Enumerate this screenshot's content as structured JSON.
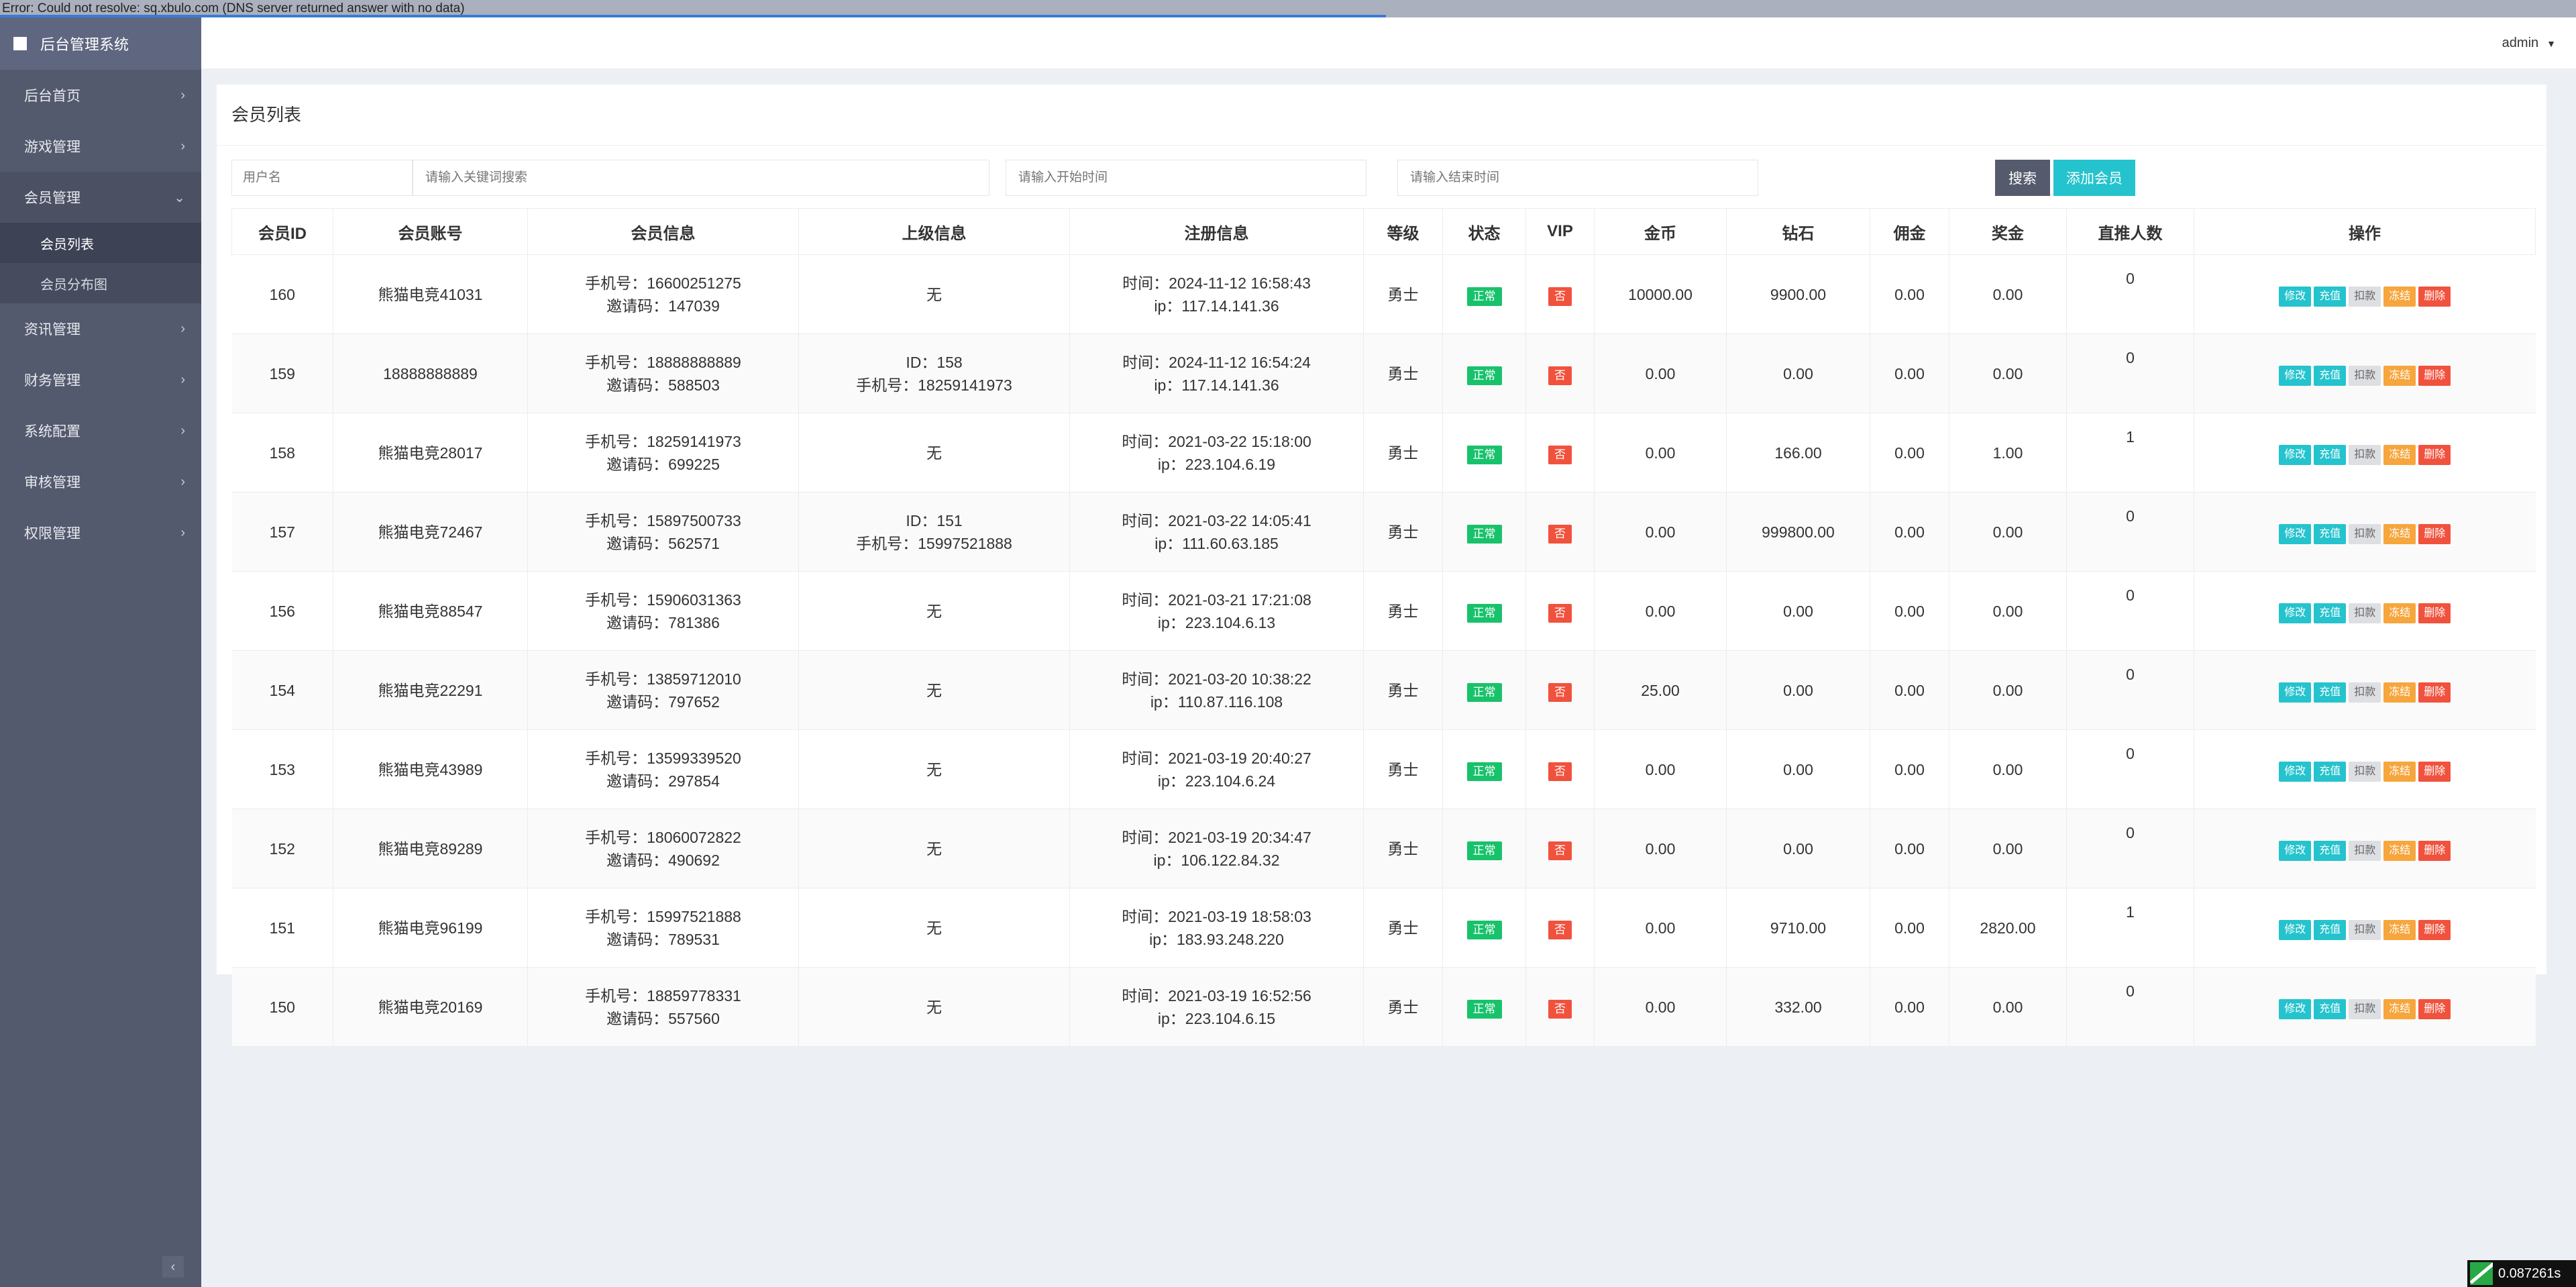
{
  "error_bar": {
    "text": "Error: Could not resolve: sq.xbulo.com (DNS server returned answer with no data)"
  },
  "sidebar": {
    "brand": "后台管理系统",
    "items": [
      {
        "label": "后台首页"
      },
      {
        "label": "游戏管理"
      },
      {
        "label": "会员管理",
        "open": true,
        "children": [
          {
            "label": "会员列表",
            "active": true
          },
          {
            "label": "会员分布图"
          }
        ]
      },
      {
        "label": "资讯管理"
      },
      {
        "label": "财务管理"
      },
      {
        "label": "系统配置"
      },
      {
        "label": "审核管理"
      },
      {
        "label": "权限管理"
      }
    ],
    "collapse_icon": "chevron-left-icon"
  },
  "header": {
    "user": "admin"
  },
  "panel": {
    "title": "会员列表",
    "search": {
      "field_label": "用户名",
      "keyword_placeholder": "请输入关键词搜索",
      "start_placeholder": "请输入开始时间",
      "end_placeholder": "请输入结束时间",
      "search_button": "搜索",
      "add_button": "添加会员"
    }
  },
  "table": {
    "headers": [
      "会员ID",
      "会员账号",
      "会员信息",
      "上级信息",
      "注册信息",
      "等级",
      "状态",
      "VIP",
      "金币",
      "钻石",
      "佣金",
      "奖金",
      "直推人数",
      "操作"
    ],
    "actions": [
      "修改",
      "充值",
      "扣款",
      "冻结",
      "删除"
    ],
    "rows": [
      {
        "id": "160",
        "account": "熊猫电竞41031",
        "phone": "手机号：16600251275",
        "invite": "邀请码：147039",
        "parent_line1": "无",
        "parent_line2": "",
        "time": "时间：2024-11-12 16:58:43",
        "ip": "ip：117.14.141.36",
        "level": "勇士",
        "status": "正常",
        "vip": "否",
        "gold": "10000.00",
        "diamond": "9900.00",
        "commission": "0.00",
        "bonus": "0.00",
        "referrals": "0"
      },
      {
        "id": "159",
        "account": "18888888889",
        "phone": "手机号：18888888889",
        "invite": "邀请码：588503",
        "parent_line1": "ID：158",
        "parent_line2": "手机号：18259141973",
        "time": "时间：2024-11-12 16:54:24",
        "ip": "ip：117.14.141.36",
        "level": "勇士",
        "status": "正常",
        "vip": "否",
        "gold": "0.00",
        "diamond": "0.00",
        "commission": "0.00",
        "bonus": "0.00",
        "referrals": "0"
      },
      {
        "id": "158",
        "account": "熊猫电竞28017",
        "phone": "手机号：18259141973",
        "invite": "邀请码：699225",
        "parent_line1": "无",
        "parent_line2": "",
        "time": "时间：2021-03-22 15:18:00",
        "ip": "ip：223.104.6.19",
        "level": "勇士",
        "status": "正常",
        "vip": "否",
        "gold": "0.00",
        "diamond": "166.00",
        "commission": "0.00",
        "bonus": "1.00",
        "referrals": "1"
      },
      {
        "id": "157",
        "account": "熊猫电竞72467",
        "phone": "手机号：15897500733",
        "invite": "邀请码：562571",
        "parent_line1": "ID：151",
        "parent_line2": "手机号：15997521888",
        "time": "时间：2021-03-22 14:05:41",
        "ip": "ip：111.60.63.185",
        "level": "勇士",
        "status": "正常",
        "vip": "否",
        "gold": "0.00",
        "diamond": "999800.00",
        "commission": "0.00",
        "bonus": "0.00",
        "referrals": "0"
      },
      {
        "id": "156",
        "account": "熊猫电竞88547",
        "phone": "手机号：15906031363",
        "invite": "邀请码：781386",
        "parent_line1": "无",
        "parent_line2": "",
        "time": "时间：2021-03-21 17:21:08",
        "ip": "ip：223.104.6.13",
        "level": "勇士",
        "status": "正常",
        "vip": "否",
        "gold": "0.00",
        "diamond": "0.00",
        "commission": "0.00",
        "bonus": "0.00",
        "referrals": "0"
      },
      {
        "id": "154",
        "account": "熊猫电竞22291",
        "phone": "手机号：13859712010",
        "invite": "邀请码：797652",
        "parent_line1": "无",
        "parent_line2": "",
        "time": "时间：2021-03-20 10:38:22",
        "ip": "ip：110.87.116.108",
        "level": "勇士",
        "status": "正常",
        "vip": "否",
        "gold": "25.00",
        "diamond": "0.00",
        "commission": "0.00",
        "bonus": "0.00",
        "referrals": "0"
      },
      {
        "id": "153",
        "account": "熊猫电竞43989",
        "phone": "手机号：13599339520",
        "invite": "邀请码：297854",
        "parent_line1": "无",
        "parent_line2": "",
        "time": "时间：2021-03-19 20:40:27",
        "ip": "ip：223.104.6.24",
        "level": "勇士",
        "status": "正常",
        "vip": "否",
        "gold": "0.00",
        "diamond": "0.00",
        "commission": "0.00",
        "bonus": "0.00",
        "referrals": "0"
      },
      {
        "id": "152",
        "account": "熊猫电竞89289",
        "phone": "手机号：18060072822",
        "invite": "邀请码：490692",
        "parent_line1": "无",
        "parent_line2": "",
        "time": "时间：2021-03-19 20:34:47",
        "ip": "ip：106.122.84.32",
        "level": "勇士",
        "status": "正常",
        "vip": "否",
        "gold": "0.00",
        "diamond": "0.00",
        "commission": "0.00",
        "bonus": "0.00",
        "referrals": "0"
      },
      {
        "id": "151",
        "account": "熊猫电竞96199",
        "phone": "手机号：15997521888",
        "invite": "邀请码：789531",
        "parent_line1": "无",
        "parent_line2": "",
        "time": "时间：2021-03-19 18:58:03",
        "ip": "ip：183.93.248.220",
        "level": "勇士",
        "status": "正常",
        "vip": "否",
        "gold": "0.00",
        "diamond": "9710.00",
        "commission": "0.00",
        "bonus": "2820.00",
        "referrals": "1"
      },
      {
        "id": "150",
        "account": "熊猫电竞20169",
        "phone": "手机号：18859778331",
        "invite": "邀请码：557560",
        "parent_line1": "无",
        "parent_line2": "",
        "time": "时间：2021-03-19 16:52:56",
        "ip": "ip：223.104.6.15",
        "level": "勇士",
        "status": "正常",
        "vip": "否",
        "gold": "0.00",
        "diamond": "332.00",
        "commission": "0.00",
        "bonus": "0.00",
        "referrals": "0"
      }
    ]
  },
  "timer": {
    "text": "0.087261s"
  },
  "colors": {
    "sidebar": "#545a6d",
    "accent": "#25c3cd",
    "status_green": "#18c26b",
    "danger": "#f0523d",
    "warning": "#f6a63c"
  }
}
